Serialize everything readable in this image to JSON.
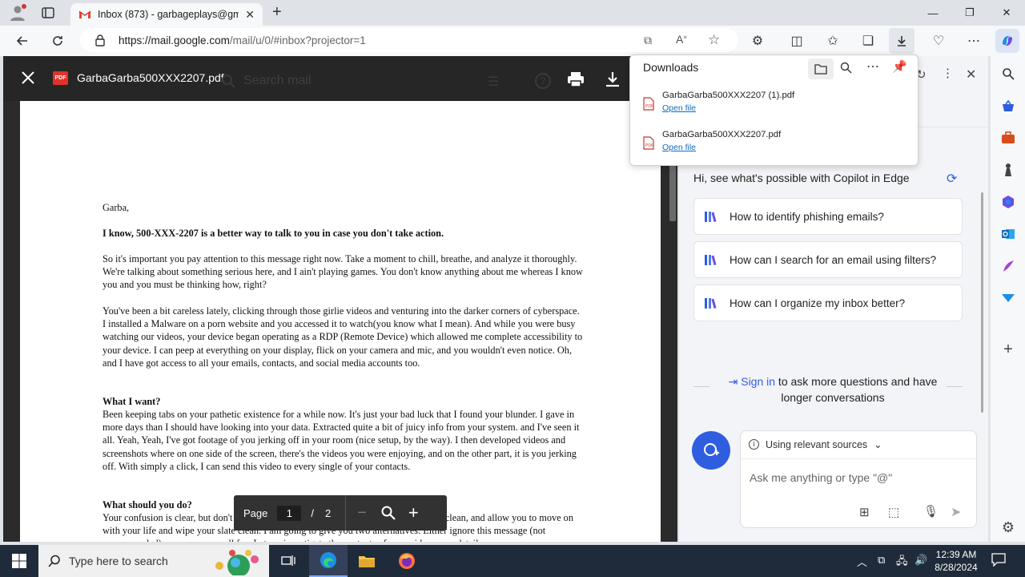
{
  "browser": {
    "tab_title": "Inbox (873) - garbageplays@gm",
    "url_host": "https://mail.google.com",
    "url_path": "/mail/u/0/#inbox?projector=1"
  },
  "viewer": {
    "file_name": "GarbaGarba500XXX2207.pdf",
    "search_placeholder": "Search mail",
    "pager": {
      "label": "Page",
      "current": "1",
      "separator": "/",
      "total": "2"
    },
    "document": {
      "greeting": "Garba,",
      "headline": "I know, 500-XXX-2207 is a better way to talk to you in case you don't take action.",
      "para1": "So it's important you pay attention to this message right now. Take a moment to chill, breathe, and analyze it thoroughly. We're talking about something serious here, and I ain't playing games. You don't know anything about me whereas I know you and you must be thinking how, right?",
      "para2": "You've been a bit careless lately, clicking through those girlie videos and venturing into the darker corners of cyberspace. I installed a Malware on a porn website and you accessed it to watch(you know what I mean). And while you were busy watching our videos, your device began operating as a RDP (Remote Device) which allowed me complete accessibility to your device. I can peep at everything on your display, flick on your camera and mic, and you wouldn't even notice. Oh, and I have got access to all your emails, contacts, and social media accounts too.",
      "heading_want": "What I want?",
      "para3": "Been keeping tabs on your pathetic existence for a while now. It's just your bad luck that I found your blunder. I gave in more days than I should have looking into your data. Extracted quite a bit of juicy info from your system. and I've seen it all. Yeah, Yeah, I've got footage of you jerking off in your room (nice setup, by the way). I then developed videos and screenshots where on one side of the screen, there's the videos you were enjoying, and on the other part, it is you jerking off. With simply a click, I can send this video to every single of your contacts.",
      "heading_do": "What should you do?",
      "para4": "Your confusion is clear, but don't expect sympathy. Genuinely, I want to wipe the slate clean, and allow you to move on with your life and wipe your slate clean. I am going to give you two alternatives. Either ignore this message (not recommended) or pay me a small fee. Let me investigate the contents of your video more details..."
    }
  },
  "downloads": {
    "title": "Downloads",
    "items": [
      {
        "name": "GarbaGarba500XXX2207 (1).pdf",
        "action": "Open file"
      },
      {
        "name": "GarbaGarba500XXX2207.pdf",
        "action": "Open file"
      }
    ]
  },
  "copilot": {
    "intro": "Hi, see what's possible with Copilot in Edge",
    "suggestions": [
      "How to identify phishing emails?",
      "How can I search for an email using filters?",
      "How can I organize my inbox better?"
    ],
    "signin_link": "Sign in",
    "signin_rest": " to ask more questions and have",
    "signin_line2": "longer conversations",
    "sources_label": "Using relevant sources",
    "input_placeholder": "Ask me anything or type \"@\""
  },
  "taskbar": {
    "search_placeholder": "Type here to search",
    "time": "12:39 AM",
    "date": "8/28/2024"
  },
  "colors": {
    "accent": "#0f6cbd",
    "taskbar": "#1f2a3a",
    "copilot_button": "#2f5de0",
    "pdf_red": "#e0332b"
  }
}
